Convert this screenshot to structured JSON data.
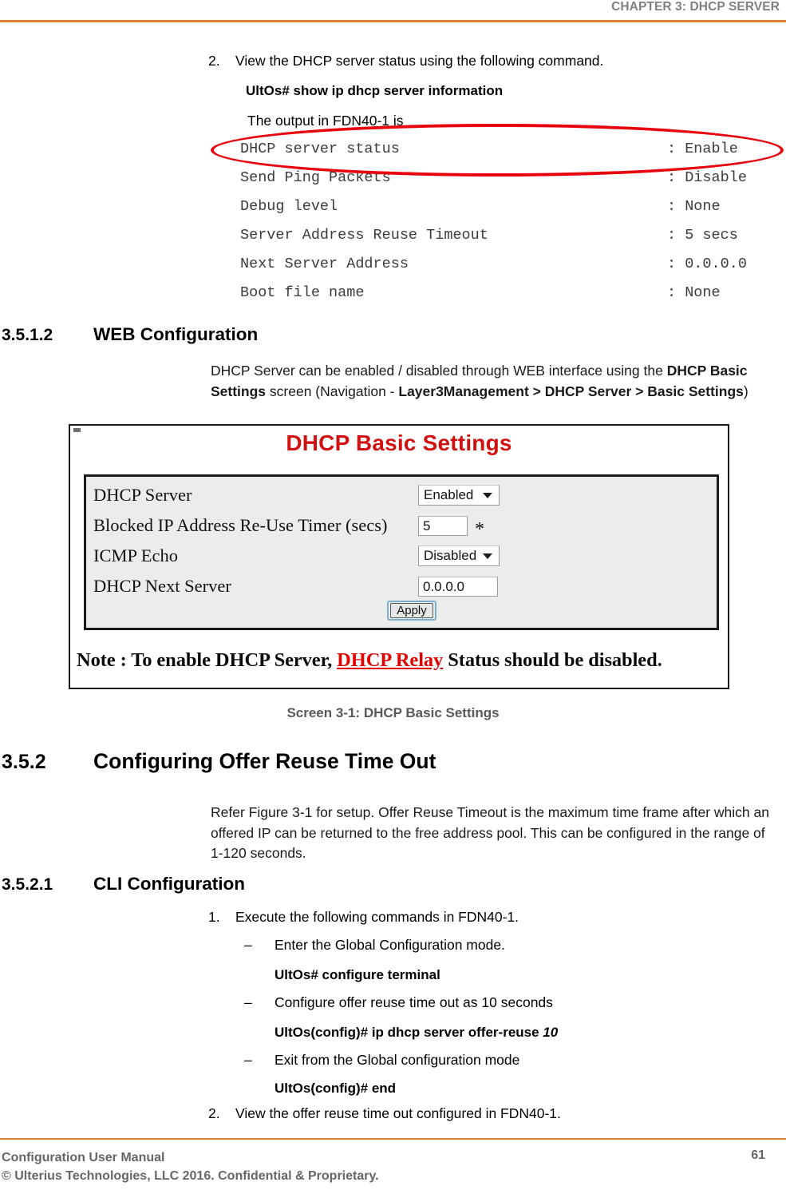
{
  "header": {
    "chapter": "CHAPTER 3: DHCP SERVER",
    "rule_color": "#E3802B"
  },
  "step_2_top": {
    "marker": "2.",
    "text": "View the DHCP server status using the following command.",
    "command": "UltOs# show ip dhcp server information",
    "output_intro": "The output in FDN40-1 is"
  },
  "terminal_output": {
    "rows": [
      {
        "key": "DHCP server status",
        "value": ": Enable"
      },
      {
        "key": "Send Ping Packets",
        "value": ": Disable"
      },
      {
        "key": "Debug level",
        "value": ": None"
      },
      {
        "key": "Server Address Reuse Timeout",
        "value": ": 5 secs"
      },
      {
        "key": "Next Server Address",
        "value": ": 0.0.0.0"
      },
      {
        "key": "Boot file name",
        "value": ": None"
      }
    ],
    "annotation": {
      "type": "ellipse",
      "color": "#E8000D",
      "targets_row": "DHCP server status"
    }
  },
  "section_web_config": {
    "number": "3.5.1.2",
    "title": "WEB Configuration",
    "paragraph_part1": "DHCP Server can be enabled / disabled through WEB interface using the ",
    "paragraph_bold1": "DHCP Basic Settings",
    "paragraph_part2": " screen (Navigation - ",
    "paragraph_bold2": "Layer3Management > DHCP Server > Basic Settings",
    "paragraph_part3": ")"
  },
  "figure": {
    "title": "DHCP Basic Settings",
    "title_color": "#CF1111",
    "rows": [
      {
        "label": "DHCP Server",
        "control": "select",
        "value": "Enabled"
      },
      {
        "label": "Blocked IP Address Re-Use Timer (secs)",
        "control": "input",
        "value": "5",
        "required_mark": "*"
      },
      {
        "label": "ICMP Echo",
        "control": "select",
        "value": "Disabled"
      },
      {
        "label": "DHCP Next Server",
        "control": "input",
        "value": "0.0.0.0"
      }
    ],
    "apply_label": "Apply",
    "note_prefix": "Note : To enable DHCP Server, ",
    "note_link": "DHCP Relay",
    "note_suffix": " Status should be disabled.",
    "caption": "Screen 3-1: DHCP Basic Settings"
  },
  "section_offer_reuse": {
    "number": "3.5.2",
    "title": "Configuring Offer Reuse Time Out",
    "paragraph": "Refer Figure 3-1 for setup. Offer Reuse Timeout is the maximum time frame after which an offered IP can be returned to the free address pool. This can be configured in the range of 1-120 seconds."
  },
  "section_cli_config": {
    "number": "3.5.2.1",
    "title": "CLI Configuration",
    "step_1": {
      "marker": "1.",
      "text": "Execute the following commands in FDN40-1."
    },
    "bullets": [
      {
        "marker": "–",
        "text": "Enter the Global Configuration mode.",
        "command": "UltOs# configure terminal",
        "command_arg": ""
      },
      {
        "marker": "–",
        "text": "Configure offer reuse time out as 10 seconds",
        "command": "UltOs(config)# ip dhcp server offer-reuse ",
        "command_arg": "10"
      },
      {
        "marker": "–",
        "text": "Exit from the Global configuration mode",
        "command": "UltOs(config)# end",
        "command_arg": ""
      }
    ],
    "step_2": {
      "marker": "2.",
      "text": "View the offer reuse time out configured in FDN40-1."
    }
  },
  "footer": {
    "manual_title": "Configuration User Manual",
    "copyright": "© Ulterius Technologies, LLC 2016. Confidential & Proprietary.",
    "page_number": "61"
  }
}
